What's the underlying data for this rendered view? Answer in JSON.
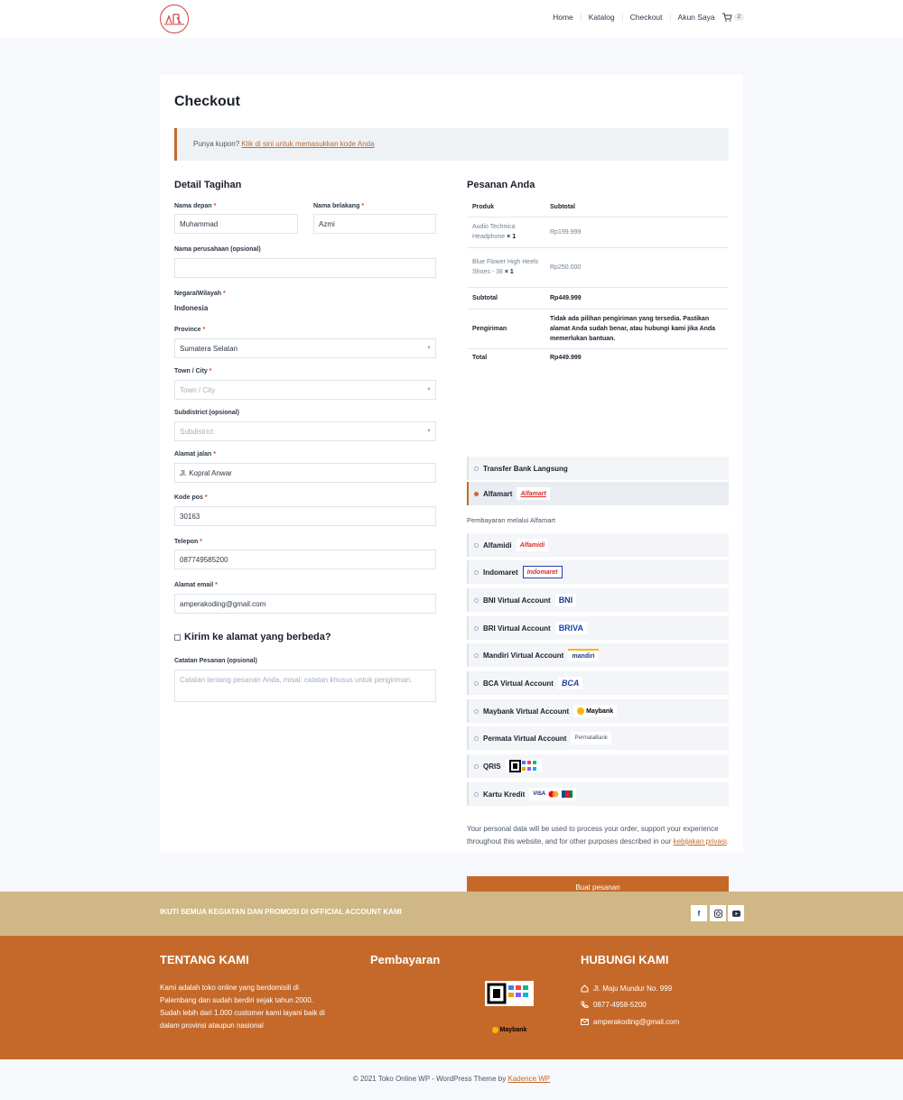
{
  "nav": {
    "items": [
      "Home",
      "Katalog",
      "Checkout",
      "Akun Saya"
    ],
    "cart_count": "2"
  },
  "page_title": "Checkout",
  "coupon": {
    "text": "Punya kupon?",
    "link": "Klik di sini untuk memasukkan kode Anda"
  },
  "billing": {
    "title": "Detail Tagihan",
    "first_name": {
      "label": "Nama depan",
      "value": "Muhammad"
    },
    "last_name": {
      "label": "Nama belakang",
      "value": "Azmi"
    },
    "company": {
      "label": "Nama perusahaan (opsional)",
      "value": ""
    },
    "country": {
      "label": "Negara/Wilayah",
      "value": "Indonesia"
    },
    "province": {
      "label": "Province",
      "value": "Sumatera Selatan"
    },
    "town": {
      "label": "Town / City",
      "placeholder": "Town / City"
    },
    "subdistrict": {
      "label": "Subdistrict (opsional)",
      "placeholder": "Subdistrict"
    },
    "address": {
      "label": "Alamat jalan",
      "value": "Jl. Kopral Anwar"
    },
    "postcode": {
      "label": "Kode pos",
      "value": "30163"
    },
    "phone": {
      "label": "Telepon",
      "value": "087749585200"
    },
    "email": {
      "label": "Alamat email",
      "value": "amperakoding@gmail.com"
    },
    "ship_diff": "Kirim ke alamat yang berbeda?",
    "notes": {
      "label": "Catatan Pesanan (opsional)",
      "placeholder": "Catatan tentang pesanan Anda, misal: catatan khusus untuk pengiriman."
    }
  },
  "order": {
    "title": "Pesanan Anda",
    "col_product": "Produk",
    "col_subtotal": "Subtotal",
    "items": [
      {
        "name": "Audio Technica Headphone",
        "qty": "× 1",
        "price": "Rp199.999"
      },
      {
        "name": "Blue Flower High Heels Shoes - 38",
        "qty": "× 1",
        "price": "Rp250.000"
      }
    ],
    "subtotal_label": "Subtotal",
    "subtotal": "Rp449.999",
    "shipping_label": "Pengiriman",
    "shipping_text": "Tidak ada pilihan pengiriman yang tersedia. Pastikan alamat Anda sudah benar, atau hubungi kami jika Anda memerlukan bantuan.",
    "total_label": "Total",
    "total": "Rp449.999"
  },
  "payments": [
    {
      "label": "Transfer Bank Langsung",
      "logo": ""
    },
    {
      "label": "Alfamart",
      "logo": "Alfamart"
    },
    {
      "label": "Alfamidi",
      "logo": "Alfamidi"
    },
    {
      "label": "Indomaret",
      "logo": "Indomaret"
    },
    {
      "label": "BNI Virtual Account",
      "logo": "BNI"
    },
    {
      "label": "BRI Virtual Account",
      "logo": "BRIVA"
    },
    {
      "label": "Mandiri Virtual Account",
      "logo": "mandiri"
    },
    {
      "label": "BCA Virtual Account",
      "logo": "BCA"
    },
    {
      "label": "Maybank Virtual Account",
      "logo": "Maybank"
    },
    {
      "label": "Permata Virtual Account",
      "logo": "PermataBank"
    },
    {
      "label": "QRIS",
      "logo": "QRIS"
    },
    {
      "label": "Kartu Kredit",
      "logo": "VISA"
    }
  ],
  "payment_desc": "Pembayaran melalui Alfamart",
  "privacy": {
    "text": "Your personal data will be used to process your order, support your experience throughout this website, and for other purposes described in our",
    "link": "kebijakan privasi"
  },
  "place_order": "Buat pesanan",
  "footer": {
    "bar_text": "IKUTI SEMUA KEGIATAN DAN PROMOSI DI OFFICIAL ACCOUNT KAMI",
    "about_title": "TENTANG KAMI",
    "about_text": "Kami adalah toko online yang berdomisili di Palembang dan sudah berdiri sejak tahun 2000. Sudah lebih dari 1.000 customer kami layani baik di dalam provinsi ataupun nasional",
    "pay_title": "Pembayaran",
    "contact_title": "HUBUNGI KAMI",
    "address": "Jl. Maju Mundur No. 999",
    "phone": "0877-4958-5200",
    "email": "amperakoding@gmail.com",
    "copyright": "© 2021 Toko Online WP - WordPress Theme by",
    "credit": "Kadence WP"
  },
  "colors": {
    "accent": "#c5692a",
    "footer_bar": "#cfb885"
  }
}
